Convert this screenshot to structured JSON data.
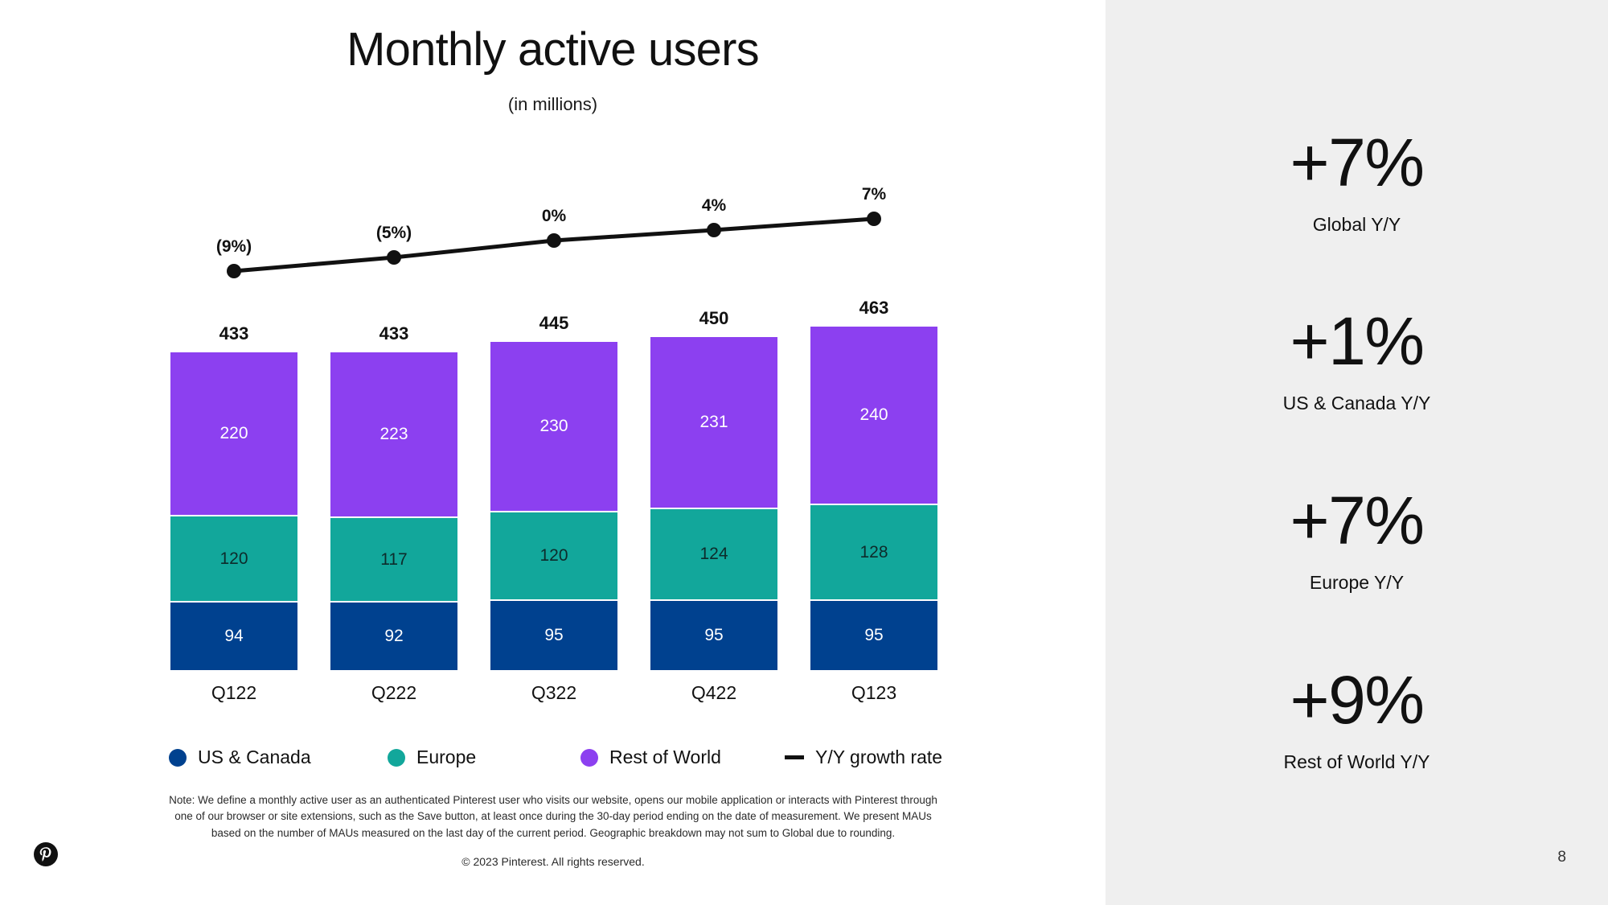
{
  "header": {
    "title": "Monthly active users",
    "subtitle": "(in millions)"
  },
  "chart_data": {
    "type": "bar",
    "subtype": "stacked-bar-with-line-overlay",
    "title": "Monthly active users",
    "subtitle": "(in millions)",
    "xlabel": "",
    "ylabel": "Monthly active users (in millions)",
    "categories": [
      "Q122",
      "Q222",
      "Q322",
      "Q422",
      "Q123"
    ],
    "series": [
      {
        "name": "US & Canada",
        "color": "#00418F",
        "values": [
          94,
          92,
          95,
          95,
          95
        ]
      },
      {
        "name": "Europe",
        "color": "#12A79B",
        "values": [
          120,
          117,
          120,
          124,
          128
        ]
      },
      {
        "name": "Rest of World",
        "color": "#8C40F0",
        "values": [
          220,
          223,
          230,
          231,
          240
        ]
      }
    ],
    "totals": [
      433,
      433,
      445,
      450,
      463
    ],
    "overlay_line": {
      "name": "Y/Y growth rate",
      "color": "#111111",
      "labels": [
        "(9%)",
        "(5%)",
        "0%",
        "4%",
        "7%"
      ],
      "values": [
        -9,
        -5,
        0,
        4,
        7
      ]
    },
    "ylim": [
      0,
      480
    ],
    "grid": false,
    "legend_position": "bottom"
  },
  "legend": [
    {
      "label": "US & Canada",
      "icon": "circle",
      "color": "#00418F"
    },
    {
      "label": "Europe",
      "icon": "circle",
      "color": "#12A79B"
    },
    {
      "label": "Rest of World",
      "icon": "circle",
      "color": "#8C40F0"
    },
    {
      "label": "Y/Y growth rate",
      "icon": "dash",
      "color": "#111111"
    }
  ],
  "footer": {
    "note": "Note: We define a monthly active user as an authenticated Pinterest user who visits our website, opens our mobile application or interacts with Pinterest through one of our browser or site extensions, such as the Save button, at least once during the 30-day period ending on the date of measurement. We present MAUs based on the number of MAUs measured on the last day of the current period. Geographic breakdown may not sum to Global due to rounding.",
    "copyright": "© 2023 Pinterest. All rights reserved.",
    "logo_name": "pinterest-logo",
    "page_number": "8"
  },
  "sidebar": {
    "background": "#efefef",
    "stats": [
      {
        "value": "+7%",
        "label": "Global Y/Y"
      },
      {
        "value": "+1%",
        "label": "US & Canada Y/Y"
      },
      {
        "value": "+7%",
        "label": "Europe Y/Y"
      },
      {
        "value": "+9%",
        "label": "Rest of World Y/Y"
      }
    ]
  }
}
